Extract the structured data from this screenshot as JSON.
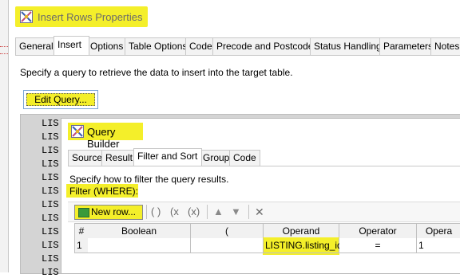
{
  "window": {
    "title": "Insert Rows Properties"
  },
  "tabs": [
    "General",
    "Insert",
    "Options",
    "Table Options",
    "Code",
    "Precode and Postcode",
    "Status Handling",
    "Parameters",
    "Notes"
  ],
  "active_tab": "Insert",
  "insert": {
    "hint": "Specify a query to retrieve the data to insert into the target table.",
    "edit_button": "Edit Query...",
    "sql_lines": [
      "LIS",
      "LIS",
      "LIS",
      "LIS",
      "LIS",
      "LIS",
      "LIS",
      "LIS",
      "LIS",
      "LIS",
      "LIS",
      "LIS"
    ]
  },
  "query_builder": {
    "title": "Query Builder",
    "tabs": [
      "Source",
      "Result",
      "Filter and Sort",
      "Group",
      "Code"
    ],
    "active_tab": "Filter and Sort",
    "hint": "Specify how to filter the query results.",
    "filter_label": "Filter (WHERE):",
    "toolbar": {
      "new_row": "New row...",
      "group_open": "( )",
      "group_x": "(x",
      "group_xx": "(x)",
      "up": "▲",
      "down": "▼",
      "delete": "✕"
    },
    "grid": {
      "columns": [
        "#",
        "Boolean",
        "(",
        "Operand",
        "Operator",
        "Opera"
      ],
      "rows": [
        {
          "num": "1",
          "boolean": "",
          "paren": "",
          "operand": "LISTING.listing_id",
          "operator": "=",
          "operand2": "1"
        }
      ]
    }
  },
  "colors": {
    "highlight": "#f4ef2a",
    "tab_border": "#c8c8c8",
    "editor_bg": "#d4d4d4"
  }
}
